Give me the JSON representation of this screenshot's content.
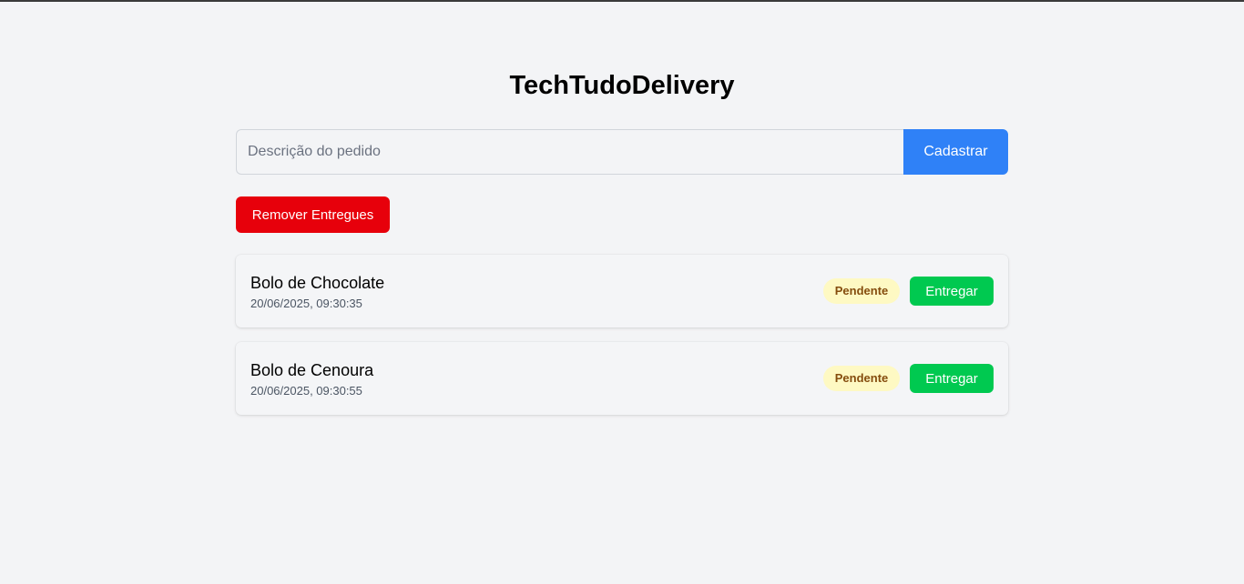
{
  "app": {
    "title": "TechTudoDelivery"
  },
  "form": {
    "input_value": "",
    "input_placeholder": "Descrição do pedido",
    "submit_label": "Cadastrar"
  },
  "actions": {
    "remove_delivered_label": "Remover Entregues"
  },
  "orders": [
    {
      "description": "Bolo de Chocolate",
      "timestamp": "20/06/2025, 09:30:35",
      "status": "Pendente",
      "action_label": "Entregar"
    },
    {
      "description": "Bolo de Cenoura",
      "timestamp": "20/06/2025, 09:30:55",
      "status": "Pendente",
      "action_label": "Entregar"
    }
  ],
  "colors": {
    "primary": "#2f81f7",
    "danger": "#e7000b",
    "success": "#00c950",
    "pending_bg": "#fef9c3",
    "pending_text": "#854d0e",
    "background": "#f3f4f6"
  }
}
